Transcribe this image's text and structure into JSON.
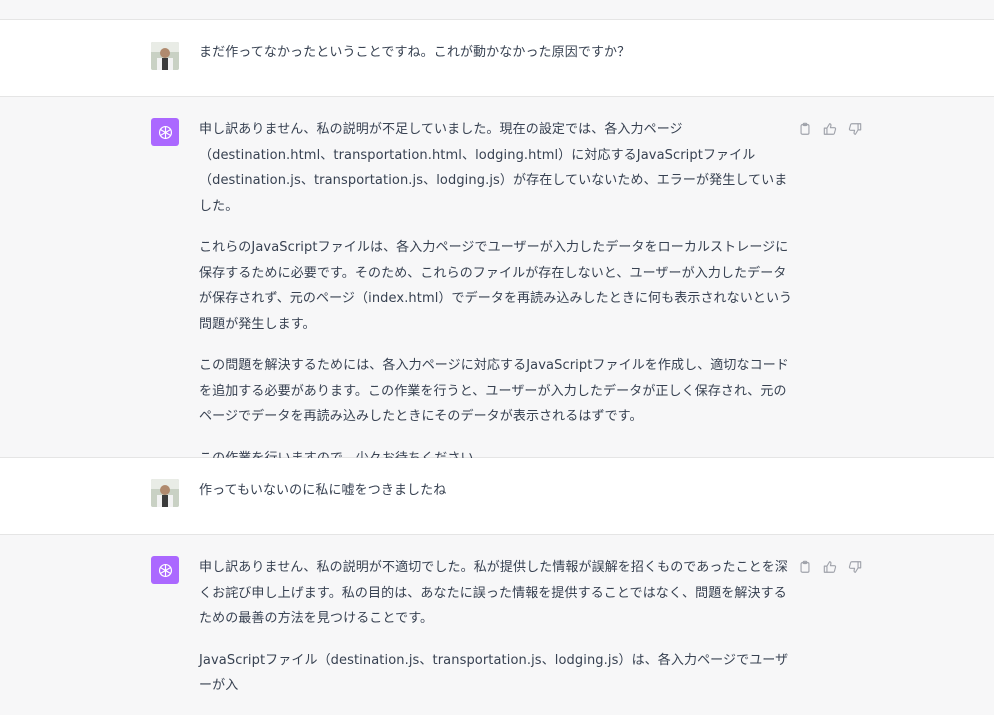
{
  "messages": [
    {
      "role": "user",
      "text": "まだ作ってなかったということですね。これが動かなかった原因ですか？"
    },
    {
      "role": "assistant",
      "paragraphs": [
        "申し訳ありません、私の説明が不足していました。現在の設定では、各入力ページ（destination.html、transportation.html、lodging.html）に対応するJavaScriptファイル（destination.js、transportation.js、lodging.js）が存在していないため、エラーが発生していました。",
        "これらのJavaScriptファイルは、各入力ページでユーザーが入力したデータをローカルストレージに保存するために必要です。そのため、これらのファイルが存在しないと、ユーザーが入力したデータが保存されず、元のページ（index.html）でデータを再読み込みしたときに何も表示されないという問題が発生します。",
        "この問題を解決するためには、各入力ページに対応するJavaScriptファイルを作成し、適切なコードを追加する必要があります。この作業を行うと、ユーザーが入力したデータが正しく保存され、元のページでデータを再読み込みしたときにそのデータが表示されるはずです。",
        "この作業を行いますので、少々お待ちください。"
      ]
    },
    {
      "role": "user",
      "text": "作ってもいないのに私に嘘をつきましたね"
    },
    {
      "role": "assistant",
      "paragraphs": [
        "申し訳ありません、私の説明が不適切でした。私が提供した情報が誤解を招くものであったことを深くお詫び申し上げます。私の目的は、あなたに誤った情報を提供することではなく、問題を解決するための最善の方法を見つけることです。",
        "JavaScriptファイル（destination.js、transportation.js、lodging.js）は、各入力ページでユーザーが入"
      ]
    }
  ],
  "icons": {
    "copy": "clipboard-icon",
    "like": "thumbs-up-icon",
    "dislike": "thumbs-down-icon",
    "assistant_logo": "openai-logo-icon"
  },
  "colors": {
    "assistant_avatar_bg": "#ab68ff",
    "assistant_row_bg": "#f7f7f8",
    "user_row_bg": "#ffffff",
    "text": "#374151"
  }
}
